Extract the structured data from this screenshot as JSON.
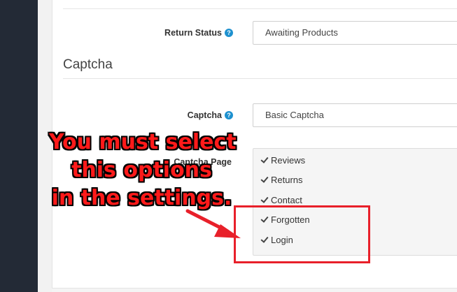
{
  "form": {
    "return_status": {
      "label": "Return Status",
      "help_icon": "question-circle-icon",
      "value": "Awaiting Products"
    },
    "captcha_section": {
      "legend": "Captcha"
    },
    "captcha": {
      "label": "Captcha",
      "help_icon": "question-circle-icon",
      "value": "Basic Captcha"
    },
    "captcha_page": {
      "label": "Captcha Page",
      "options": [
        {
          "label": "Reviews",
          "checked": true
        },
        {
          "label": "Returns",
          "checked": true
        },
        {
          "label": "Contact",
          "checked": true
        },
        {
          "label": "Forgotten",
          "checked": true
        },
        {
          "label": "Login",
          "checked": true
        }
      ]
    }
  },
  "annotation": {
    "line1": "You must select",
    "line2": "this options",
    "line3": "in the settings.",
    "color": "#ff1a1a"
  },
  "colors": {
    "sidebar": "#232a36",
    "help_icon": "#1e91cf",
    "highlight": "#e8202a"
  }
}
